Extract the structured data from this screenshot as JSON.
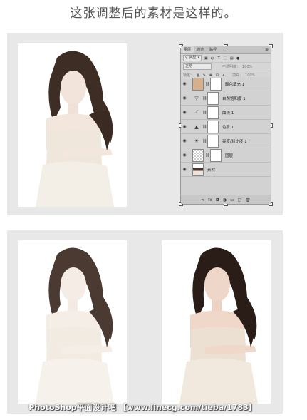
{
  "caption": "这张调整后的素材是这样的。",
  "ps_panel": {
    "tabs": [
      "图层",
      "通道",
      "路径"
    ],
    "filter_kind": "类型",
    "blend_mode": "正常",
    "opacity_label": "不透明度：",
    "opacity_value": "100%",
    "lock_label": "锁定：",
    "fill_label": "填充：",
    "fill_value": "100%",
    "layers": [
      {
        "name": "颜色填充 1",
        "icon": "solid-color-thumb",
        "color": "#d6b08a"
      },
      {
        "name": "自然饱和度 1",
        "icon": "vibrance-icon"
      },
      {
        "name": "曲线 1",
        "icon": "curves-icon"
      },
      {
        "name": "色阶 1",
        "icon": "levels-icon"
      },
      {
        "name": "亮度/对比度 1",
        "icon": "brightness-icon"
      },
      {
        "name": "图层",
        "icon": "transparent-thumb"
      },
      {
        "name": "素材",
        "icon": "photo-thumb"
      }
    ],
    "footer_icons": [
      "link-icon",
      "fx-icon",
      "mask-icon",
      "adjustment-icon",
      "group-icon",
      "new-layer-icon",
      "trash-icon"
    ]
  },
  "watermark": "PhotoShop平面设计吧 【www.linecg.com/tieba/1783】",
  "colors": {
    "panel_bg": "#e8e8e8",
    "ps_bg": "#d6d6d6",
    "hair": "#3a2a22",
    "skin": "#f1e2d8"
  }
}
